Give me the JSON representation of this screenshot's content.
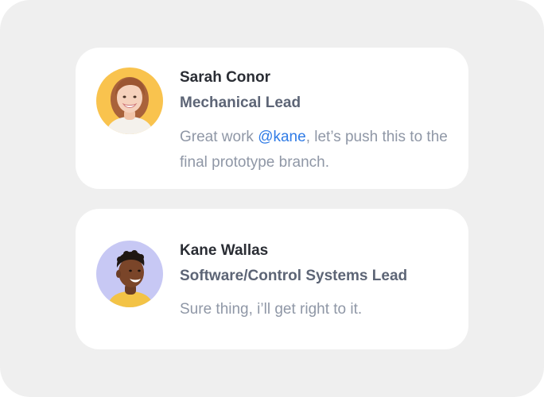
{
  "comments": [
    {
      "author": "Sarah Conor",
      "role": "Mechanical Lead",
      "message_prefix": "Great work ",
      "mention": "@kane",
      "message_suffix": ", let’s push this to the final prototype branch.",
      "avatar": "portrait-woman-smiling",
      "avatar_bg": "#f9c34e"
    },
    {
      "author": "Kane Wallas",
      "role": "Software/Control Systems Lead",
      "message": "Sure thing, i’ll get right to it.",
      "avatar": "portrait-man-smiling",
      "avatar_bg": "#c7c8f4"
    }
  ],
  "colors": {
    "mention": "#2f7be6",
    "name": "#2a2d34",
    "role": "#5d6576",
    "message": "#8f97a6",
    "panel": "#efefef",
    "card": "#ffffff"
  }
}
